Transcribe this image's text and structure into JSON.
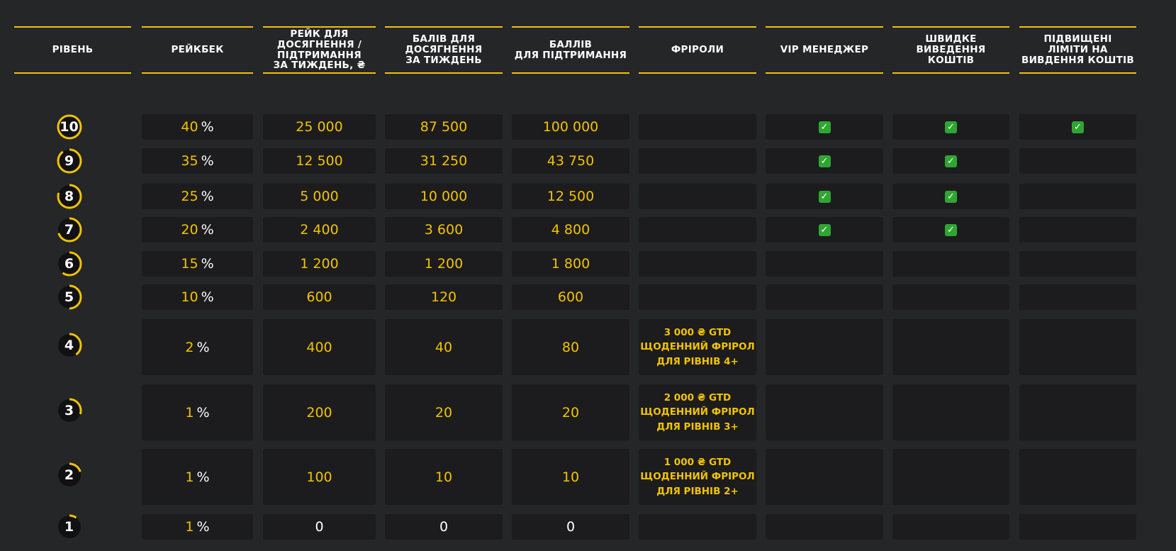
{
  "colors": {
    "accent": "#f2c300",
    "cell_bg": "#1c1c1e",
    "page_bg": "#252628",
    "check": "#2fa632"
  },
  "headers": [
    [
      "РІВЕНЬ"
    ],
    [
      "РЕЙКБЕК"
    ],
    [
      "РЕЙК ДЛЯ",
      "ДОСЯГНЕННЯ /",
      "ПІДТРИМАННЯ",
      "ЗА ТИЖДЕНЬ, ₴"
    ],
    [
      "БАЛІВ ДЛЯ",
      "ДОСЯГНЕННЯ",
      "ЗА ТИЖДЕНЬ"
    ],
    [
      "БАЛЛІВ",
      "ДЛЯ ПІДТРИМАННЯ"
    ],
    [
      "ФРІРОЛИ"
    ],
    [
      "VIP МЕНЕДЖЕР"
    ],
    [
      "ШВИДКЕ",
      "ВИВЕДЕННЯ",
      "КОШТІВ"
    ],
    [
      "ПІДВИЩЕНІ",
      "ЛІМІТИ НА",
      "ВИВДЕННЯ КОШТІВ"
    ]
  ],
  "rows": [
    {
      "level": "10",
      "progress": 1.0,
      "rakeback": "40",
      "rake": "25 000",
      "points_reach": "87 500",
      "points_keep": "100 000",
      "freeroll": [],
      "vip": true,
      "fast": true,
      "limits": true
    },
    {
      "level": "9",
      "progress": 0.9,
      "rakeback": "35",
      "rake": "12 500",
      "points_reach": "31 250",
      "points_keep": "43 750",
      "freeroll": [],
      "vip": true,
      "fast": true,
      "limits": false
    },
    {
      "level": "8",
      "progress": 0.8,
      "rakeback": "25",
      "rake": "5 000",
      "points_reach": "10 000",
      "points_keep": "12 500",
      "freeroll": [],
      "vip": true,
      "fast": true,
      "limits": false
    },
    {
      "level": "7",
      "progress": 0.7,
      "rakeback": "20",
      "rake": "2 400",
      "points_reach": "3 600",
      "points_keep": "4 800",
      "freeroll": [],
      "vip": true,
      "fast": true,
      "limits": false
    },
    {
      "level": "6",
      "progress": 0.6,
      "rakeback": "15",
      "rake": "1 200",
      "points_reach": "1 200",
      "points_keep": "1 800",
      "freeroll": [],
      "vip": false,
      "fast": false,
      "limits": false
    },
    {
      "level": "5",
      "progress": 0.5,
      "rakeback": "10",
      "rake": "600",
      "points_reach": "120",
      "points_keep": "600",
      "freeroll": [],
      "vip": false,
      "fast": false,
      "limits": false
    },
    {
      "level": "4",
      "progress": 0.4,
      "rakeback": "2",
      "rake": "400",
      "points_reach": "40",
      "points_keep": "80",
      "freeroll": [
        "3 000 ₴ GTD",
        "ЩОДЕННИЙ ФРІРОЛ",
        "ДЛЯ РІВНІВ 4+"
      ],
      "vip": false,
      "fast": false,
      "limits": false
    },
    {
      "level": "3",
      "progress": 0.3,
      "rakeback": "1",
      "rake": "200",
      "points_reach": "20",
      "points_keep": "20",
      "freeroll": [
        "2 000 ₴ GTD",
        "ЩОДЕННИЙ ФРІРОЛ",
        "ДЛЯ РІВНІВ 3+"
      ],
      "vip": false,
      "fast": false,
      "limits": false
    },
    {
      "level": "2",
      "progress": 0.2,
      "rakeback": "1",
      "rake": "100",
      "points_reach": "10",
      "points_keep": "10",
      "freeroll": [
        "1 000 ₴ GTD",
        "ЩОДЕННИЙ ФРІРОЛ",
        "ДЛЯ РІВНІВ 2+"
      ],
      "vip": false,
      "fast": false,
      "limits": false
    },
    {
      "level": "1",
      "progress": 0.1,
      "rakeback": "1",
      "rake": "0",
      "points_reach": "0",
      "points_keep": "0",
      "freeroll": [],
      "vip": false,
      "fast": false,
      "limits": false
    }
  ],
  "labels": {
    "percent": "%",
    "check": "✓"
  }
}
